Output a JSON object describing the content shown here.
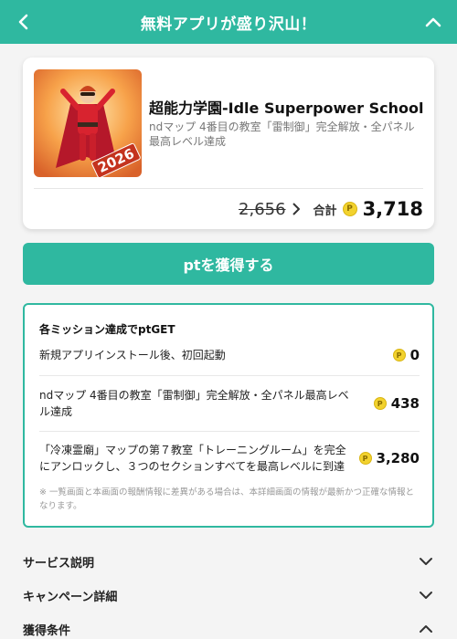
{
  "header": {
    "title": "無料アプリが盛り沢山！",
    "back_icon": "chevron-left-icon",
    "collapse_icon": "chevron-up-icon",
    "color": "#2fb8a0"
  },
  "app": {
    "name": "超能力学園-Idle Superpower School",
    "description": "ndマップ 4番目の教室「雷制御」完全解放・全パネル最高レベル達成",
    "icon_badge": "2026",
    "old_points": "2,656",
    "total_label": "合計",
    "total_points": "3,718",
    "coin_symbol": "P"
  },
  "cta": {
    "label": "ptを獲得する"
  },
  "missions": {
    "title": "各ミッション達成でptGET",
    "items": [
      {
        "text": "新規アプリインストール後、初回起動",
        "points": "0"
      },
      {
        "text": "ndマップ 4番目の教室「雷制御」完全解放・全パネル最高レベル達成",
        "points": "438"
      },
      {
        "text": "「冷凍霊廟」マップの第７教室「トレーニングルーム」を完全にアンロックし、３つのセクションすべてを最高レベルに到達",
        "points": "3,280"
      }
    ],
    "note": "※ 一覧画面と本画面の報酬情報に差異がある場合は、本詳細画面の情報が最新かつ正確な情報となります。"
  },
  "accordions": [
    {
      "label": "サービス説明",
      "icon": "chevron-down-icon"
    },
    {
      "label": "キャンペーン詳細",
      "icon": "chevron-down-icon"
    },
    {
      "label": "獲得条件",
      "icon": "chevron-up-icon"
    }
  ]
}
